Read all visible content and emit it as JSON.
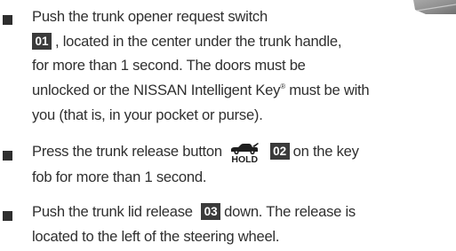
{
  "icons": {
    "bullet": "black-square",
    "key_button": "car-trunk-open-icon"
  },
  "items": [
    {
      "callout": "01",
      "line1": "Push the trunk opener request switch",
      "line2": ", located in the center under the trunk handle,",
      "line3": "for more than 1 second. The doors must be",
      "line4": "unlocked or the NISSAN Intelligent Key",
      "reg_mark": "®",
      "line4_end": " must be with",
      "line5": "you (that is, in your pocket or purse)."
    },
    {
      "line1_start": "Press the trunk release button",
      "hold_label": "HOLD",
      "callout": "02",
      "line1_end": "on the key",
      "line2": "fob for more than 1 second."
    },
    {
      "line1_start": "Push the trunk lid release",
      "callout": "03",
      "line1_end": "down. The release is",
      "line2": "located to the left of the steering wheel."
    }
  ]
}
